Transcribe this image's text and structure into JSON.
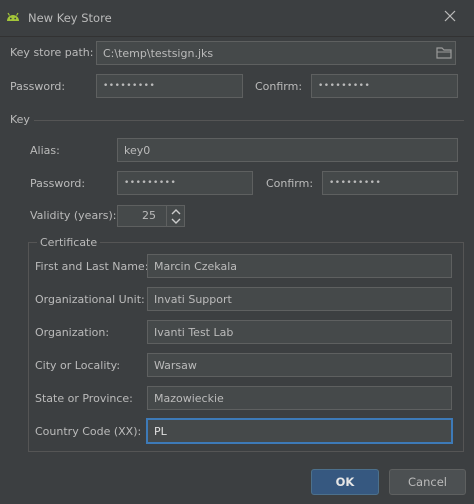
{
  "window": {
    "title": "New Key Store",
    "icon": "android-icon",
    "close_icon": "close-icon"
  },
  "keystore": {
    "path_label": "Key store path:",
    "path_value": "C:\\temp\\testsign.jks",
    "password_label": "Password:",
    "password_value": "•••••••••",
    "confirm_label": "Confirm:",
    "confirm_value": "•••••••••"
  },
  "key": {
    "section_label": "Key",
    "alias_label": "Alias:",
    "alias_value": "key0",
    "password_label": "Password:",
    "password_value": "•••••••••",
    "confirm_label": "Confirm:",
    "confirm_value": "•••••••••",
    "validity_label": "Validity (years):",
    "validity_value": "25"
  },
  "certificate": {
    "section_label": "Certificate",
    "name_label": "First and Last Name:",
    "name_value": "Marcin Czekala",
    "unit_label": "Organizational Unit:",
    "unit_value": "Invati Support",
    "org_label": "Organization:",
    "org_value": "Ivanti Test Lab",
    "city_label": "City or Locality:",
    "city_value": "Warsaw",
    "state_label": "State or Province:",
    "state_value": "Mazowieckie",
    "country_label": "Country Code (XX):",
    "country_value": "PL"
  },
  "buttons": {
    "ok": "OK",
    "cancel": "Cancel"
  },
  "colors": {
    "background": "#3c3f41",
    "field": "#45494a",
    "accent": "#365880",
    "focus": "#3d7ab8",
    "android_green": "#a4c639"
  }
}
